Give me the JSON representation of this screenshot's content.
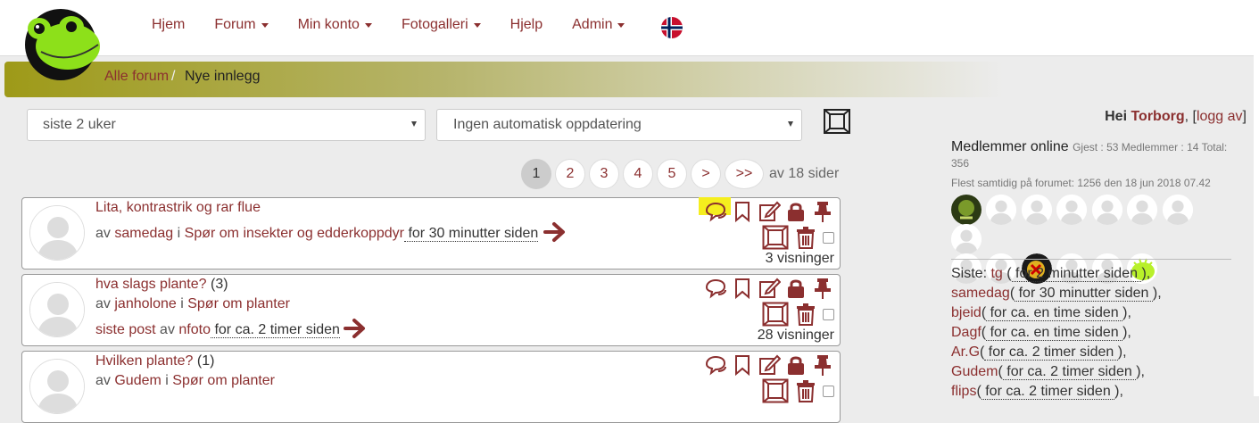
{
  "nav": {
    "items": [
      {
        "label": "Hjem",
        "dropdown": false
      },
      {
        "label": "Forum",
        "dropdown": true
      },
      {
        "label": "Min konto",
        "dropdown": true
      },
      {
        "label": "Fotogalleri",
        "dropdown": true
      },
      {
        "label": "Hjelp",
        "dropdown": false
      },
      {
        "label": "Admin",
        "dropdown": true
      }
    ]
  },
  "breadcrumb": {
    "root": "Alle forum",
    "sep": "/",
    "current": "Nye innlegg"
  },
  "filters": {
    "period": "siste 2 uker",
    "refresh": "Ingen automatisk oppdatering"
  },
  "pager": {
    "pages": [
      "1",
      "2",
      "3",
      "4",
      "5",
      ">",
      ">>"
    ],
    "active": "1",
    "of_text": "av 18 sider"
  },
  "posts": [
    {
      "title": "Lita, kontrastrik og rar flue",
      "count": "",
      "by": "av",
      "author": "samedag",
      "in": "i",
      "forum": "Spør om insekter og edderkoppdyr",
      "time": " for 30 minutter siden ",
      "last_prefix": "",
      "last_by": "",
      "last_author": "",
      "last_time": "",
      "views": "3 visninger",
      "highlight": true
    },
    {
      "title": "hva slags plante?",
      "count": "(3)",
      "by": "av",
      "author": "janholone",
      "in": "i",
      "forum": "Spør om planter",
      "time": "",
      "last_prefix": "siste post",
      "last_by": "av",
      "last_author": "nfoto",
      "last_time": " for ca. 2 timer siden ",
      "views": "28 visninger",
      "highlight": false
    },
    {
      "title": "Hvilken plante?",
      "count": "(1)",
      "by": "av",
      "author": "Gudem",
      "in": "i",
      "forum": "Spør om planter",
      "time": "",
      "last_prefix": "",
      "last_by": "",
      "last_author": "",
      "last_time": "",
      "views": "",
      "highlight": false
    }
  ],
  "user": {
    "greeting": "Hei",
    "name": "Torborg",
    "logout": "logg av"
  },
  "online": {
    "title": "Medlemmer online",
    "stats": "Gjest : 53 Medlemmer : 14 Total: 356",
    "record": "Flest samtidig på forumet: 1256 den 18 jun 2018 07.42"
  },
  "siste": {
    "label": "Siste:",
    "entries": [
      {
        "name": "tg",
        "time": " for 2 minutter siden "
      },
      {
        "name": "samedag",
        "time": " for 30 minutter siden "
      },
      {
        "name": "bjeid",
        "time": " for ca. en time siden "
      },
      {
        "name": "Dagf",
        "time": " for ca. en time siden "
      },
      {
        "name": "Ar.G",
        "time": " for ca. 2 timer siden "
      },
      {
        "name": "Gudem",
        "time": " for ca. 2 timer siden "
      },
      {
        "name": "flips",
        "time": " for ca. 2 timer siden "
      }
    ]
  },
  "colors": {
    "accent": "#8b2f2f",
    "highlight": "#f5ee1e",
    "crumb": "#9e9a18"
  }
}
